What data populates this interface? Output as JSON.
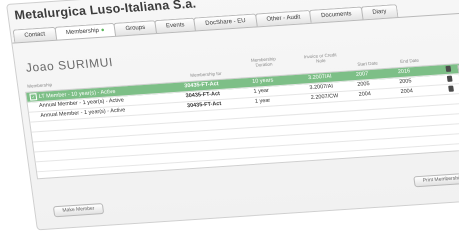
{
  "app": {
    "title": "Metalurgica Luso-Italiana S.a."
  },
  "tabs": [
    {
      "label": "Contact"
    },
    {
      "label": "Membership",
      "active_marker": "●"
    },
    {
      "label": "Groups"
    },
    {
      "label": "Events"
    },
    {
      "label": "DocShare - EU"
    },
    {
      "label": "Other - Audit"
    },
    {
      "label": "Documents"
    },
    {
      "label": "Diary"
    }
  ],
  "person": {
    "name": "Joao SURIMUI"
  },
  "table": {
    "headers": {
      "membership": "Membership",
      "membership_for": "Membership for",
      "duration": "Membership Duration",
      "invoice": "Invoice or Credit Note",
      "start": "Start Date",
      "end": "End Date"
    },
    "rows": [
      {
        "membership": "LT Member - 10 year(s) - Active",
        "for": "30435-FT-Act",
        "duration": "10 years",
        "invoice": "3.2007/AI",
        "start": "2007",
        "end": "2016",
        "selected": true,
        "icon": "document-icon"
      },
      {
        "membership": "Annual Member - 1 year(s) - Active",
        "for": "30435-FT-Act",
        "duration": "1 year",
        "invoice": "3.2007/AI",
        "start": "2005",
        "end": "2005",
        "selected": false,
        "icon": "document-icon"
      },
      {
        "membership": "Annual Member - 1 year(s) - Active",
        "for": "30435-FT-Act",
        "duration": "1 year",
        "invoice": "2.2007/CW",
        "start": "2004",
        "end": "2004",
        "selected": false,
        "icon": "document-icon"
      }
    ]
  },
  "buttons": {
    "make_member": "Make Member",
    "print_cards": "Print Membership Cards"
  },
  "colors": {
    "selected_row": "#7dbf87",
    "active_dot": "#5ab65a"
  },
  "icons": {
    "print": "printer-icon",
    "check": "checkbox-icon"
  }
}
